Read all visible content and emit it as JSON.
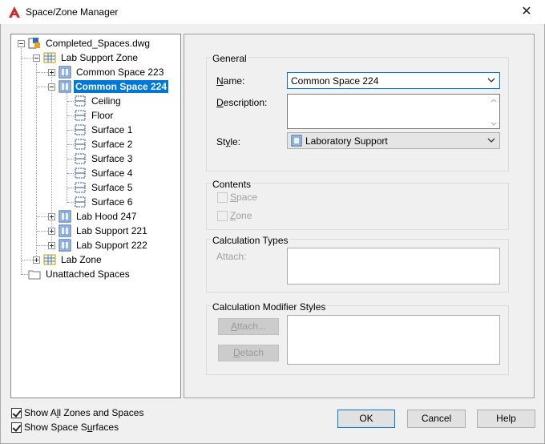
{
  "window": {
    "title": "Space/Zone Manager",
    "close_glyph": "✕",
    "app_icon": "autocad-a-icon"
  },
  "tree": {
    "root": "Completed_Spaces.dwg",
    "lab_support_zone": "Lab Support Zone",
    "common_space_223": "Common Space 223",
    "common_space_224": "Common Space 224",
    "ceiling": "Ceiling",
    "floor": "Floor",
    "surface1": "Surface 1",
    "surface2": "Surface 2",
    "surface3": "Surface 3",
    "surface4": "Surface 4",
    "surface5": "Surface 5",
    "surface6": "Surface 6",
    "lab_hood_247": "Lab Hood 247",
    "lab_support_221": "Lab Support 221",
    "lab_support_222": "Lab Support 222",
    "lab_zone": "Lab Zone",
    "unattached": "Unattached Spaces"
  },
  "general": {
    "title": "General",
    "name_label_u": "N",
    "name_label_rest": "ame:",
    "name_value": "Common Space 224",
    "description_label_u": "D",
    "description_label_rest": "escription:",
    "description_value": "",
    "style_label_pre": "St",
    "style_label_u": "y",
    "style_label_rest": "le:",
    "style_value": "Laboratory Support"
  },
  "contents": {
    "title": "Contents",
    "space_u": "S",
    "space_rest": "pace",
    "zone_u": "Z",
    "zone_rest": "one"
  },
  "calculation_types": {
    "title": "Calculation Types",
    "attach_label": "Attach:"
  },
  "calc_modifiers": {
    "title": "Calculation Modifier Styles",
    "attach_u": "A",
    "attach_rest": "ttach...",
    "detach_u": "D",
    "detach_rest": "etach"
  },
  "options": {
    "show_all_pre": "Show A",
    "show_all_u": "l",
    "show_all_rest": "l Zones and Spaces",
    "show_all_checked": true,
    "show_surfaces_pre": "Show Space S",
    "show_surfaces_u": "u",
    "show_surfaces_rest": "rfaces",
    "show_surfaces_checked": true
  },
  "buttons": {
    "ok": "OK",
    "cancel": "Cancel",
    "help": "Help"
  },
  "colors": {
    "selection": "#0078d7",
    "focus_border": "#0078d7"
  }
}
